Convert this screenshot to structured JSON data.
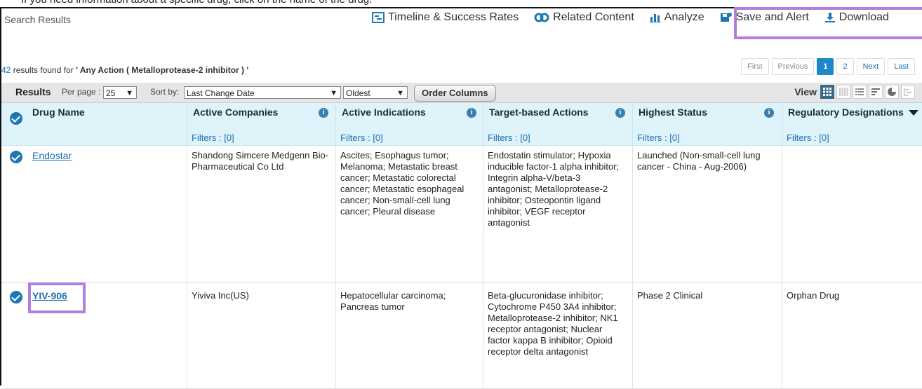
{
  "top_strip_text": "If you need information about a specific drug, click on the name of the drug.",
  "page": {
    "title": "Search Results"
  },
  "actions": [
    {
      "label": "Timeline & Success Rates",
      "icon": "timeline-icon"
    },
    {
      "label": "Related Content",
      "icon": "related-content-icon"
    },
    {
      "label": "Analyze",
      "icon": "analyze-chart-icon"
    },
    {
      "label": "Save and Alert",
      "icon": "save-alert-icon"
    },
    {
      "label": "Download",
      "icon": "download-icon"
    }
  ],
  "results_summary": {
    "count": "42",
    "text_mid": " results found for ",
    "query": "' Any Action ( Metalloprotease-2 inhibitor ) '"
  },
  "pagination": {
    "first": "First",
    "previous": "Previous",
    "pages": [
      "1",
      "2"
    ],
    "next": "Next",
    "last": "Last",
    "current": "1"
  },
  "toolbar": {
    "results_label": "Results",
    "per_page_label": "Per page :",
    "per_page_value": "25",
    "sort_label": "Sort by:",
    "sort_value": "Last Change Date",
    "order_value": "Oldest",
    "order_columns": "Order Columns",
    "view_label": "View"
  },
  "columns": [
    {
      "name": "Drug Name",
      "filters": ""
    },
    {
      "name": "Active Companies",
      "filters": "Filters : [0]"
    },
    {
      "name": "Active Indications",
      "filters": "Filters : [0]"
    },
    {
      "name": "Target-based Actions",
      "filters": "Filters : [0]"
    },
    {
      "name": "Highest Status",
      "filters": "Filters : [0]"
    },
    {
      "name": "Regulatory Designations",
      "filters": "Filters : [0]"
    }
  ],
  "rows": [
    {
      "drug": "Endostar",
      "companies": "Shandong Simcere Medgenn Bio-Pharmaceutical Co Ltd",
      "indications": "Ascites; Esophagus tumor; Melanoma; Metastatic breast cancer; Metastatic colorectal cancer; Metastatic esophageal cancer; Non-small-cell lung cancer; Pleural disease",
      "actions": "Endostatin stimulator; Hypoxia inducible factor-1 alpha inhibitor; Integrin alpha-V/beta-3 antagonist; Metalloprotease-2 inhibitor; Osteopontin ligand inhibitor; VEGF receptor antagonist",
      "status": "Launched (Non-small-cell lung cancer - China - Aug-2006)",
      "designations": ""
    },
    {
      "drug": "YIV-906",
      "companies": "Yiviva Inc(US)",
      "indications": "Hepatocellular carcinoma; Pancreas tumor",
      "actions": "Beta-glucuronidase inhibitor; Cytochrome P450 3A4 inhibitor; Metalloprotease-2 inhibitor; NK1 receptor antagonist; Nuclear factor kappa B inhibitor; Opioid receptor delta antagonist",
      "status": "Phase 2 Clinical",
      "designations": "Orphan Drug"
    }
  ],
  "colors": {
    "link": "#1f6fb2",
    "header_bg": "#dff3fb",
    "highlight": "#b27ee0",
    "accent": "#1d77b5"
  }
}
